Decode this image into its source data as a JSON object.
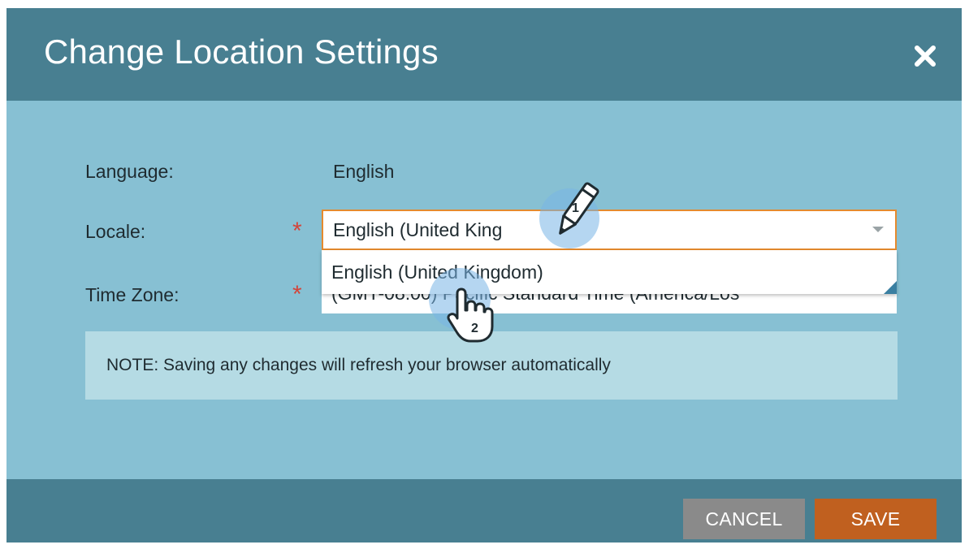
{
  "dialog": {
    "title": "Change Location Settings",
    "close_icon": "close-icon"
  },
  "form": {
    "language_label": "Language:",
    "language_value": "English",
    "locale_label": "Locale:",
    "locale_input_value": "English (United King",
    "locale_dropdown_option": "English (United Kingdom)",
    "timezone_label": "Time Zone:",
    "timezone_value": "(GMT-08:00) Pacific Standard Time (America/Los",
    "required_marker": "*"
  },
  "note": {
    "text": "NOTE: Saving any changes will refresh your browser automatically"
  },
  "footer": {
    "cancel_label": "CANCEL",
    "save_label": "SAVE"
  },
  "annotations": {
    "step1": "1",
    "step2": "2",
    "step1_icon": "pencil-icon",
    "step2_icon": "hand-pointer-icon"
  },
  "colors": {
    "header_bg": "#487f91",
    "body_bg": "#87c0d3",
    "note_bg": "#b5dbe4",
    "required": "#d3443a",
    "focus_border": "#e58a2e",
    "cancel_bg": "#8a8a8a",
    "save_bg": "#c0601f"
  }
}
